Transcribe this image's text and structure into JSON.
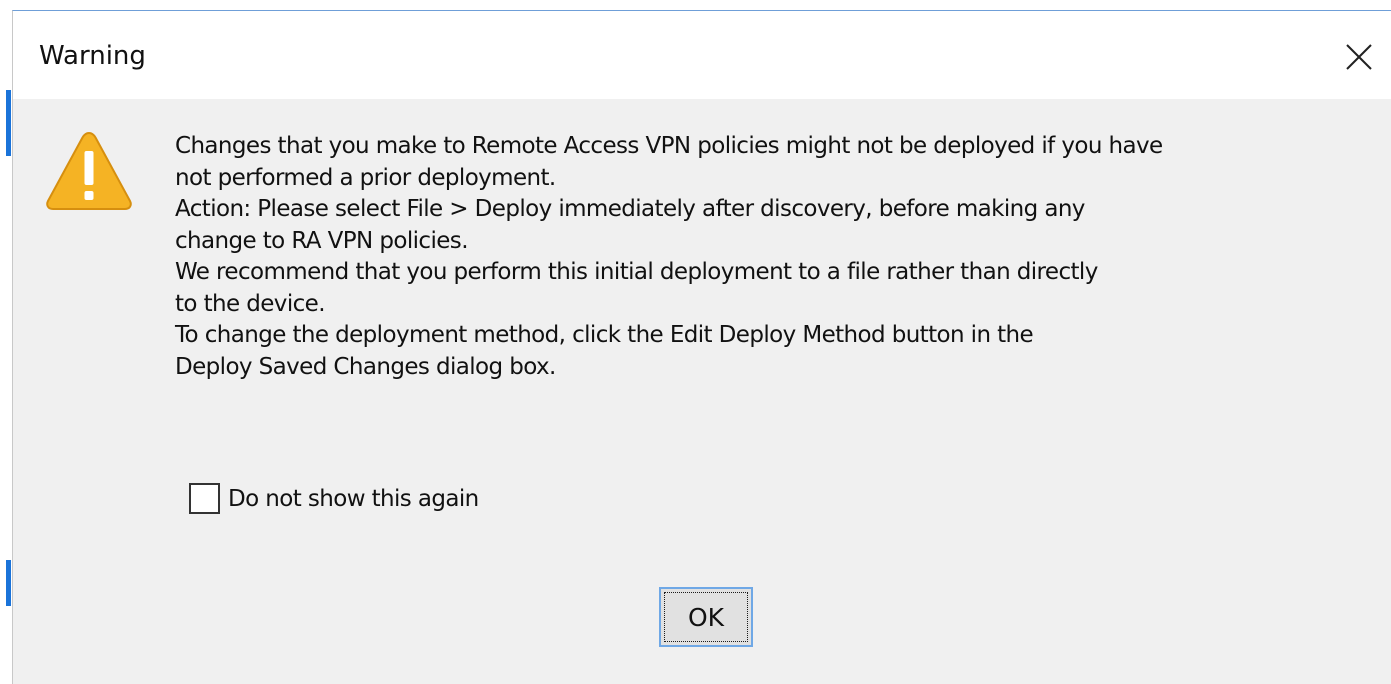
{
  "dialog": {
    "title": "Warning",
    "close_icon": "close-icon",
    "warning_icon": "warning-triangle-icon",
    "message_lines": [
      "Changes that you make to Remote Access VPN policies might not be deployed if you have",
      "not performed a prior deployment.",
      "Action: Please select File > Deploy immediately after discovery, before making any",
      "change to RA VPN policies.",
      "We recommend that you perform this initial deployment to a file rather than directly",
      "to the device.",
      "To change the deployment method, click the Edit Deploy Method button in the",
      "Deploy Saved Changes dialog box."
    ],
    "checkbox": {
      "label": "Do not show this again",
      "checked": false
    },
    "ok_label": "OK"
  },
  "colors": {
    "accent": "#1a73d9",
    "warning_fill": "#f5b324",
    "dialog_bg": "#f0f0f0",
    "button_border": "#6fa8e6"
  }
}
